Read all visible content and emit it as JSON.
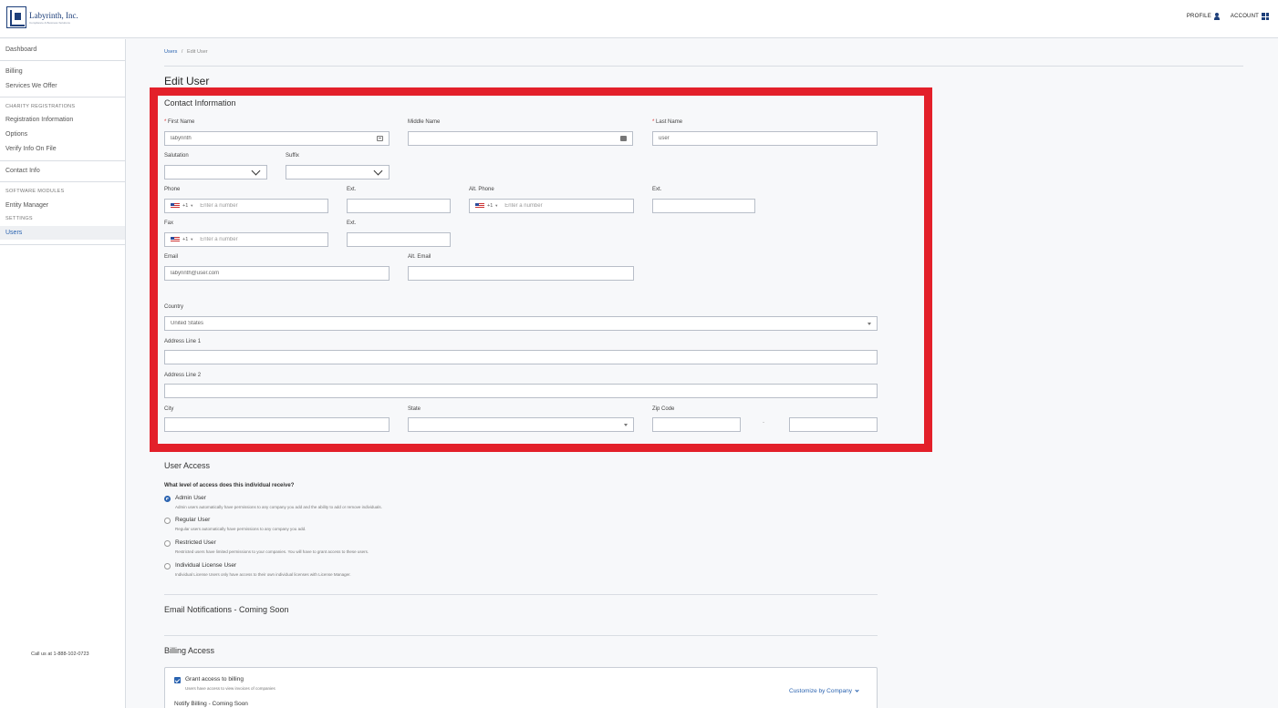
{
  "header": {
    "logo_text": "Labyrinth, Inc.",
    "logo_tagline": "Compliance & Business Solutions",
    "profile_label": "PROFILE",
    "account_label": "ACCOUNT"
  },
  "sidebar": {
    "items": {
      "dashboard": "Dashboard",
      "billing": "Billing",
      "services": "Services We Offer",
      "charity_heading": "CHARITY REGISTRATIONS",
      "registration_info": "Registration Information",
      "options": "Options",
      "verify_info": "Verify Info On File",
      "contact_info": "Contact Info",
      "software_heading": "SOFTWARE MODULES",
      "entity_manager": "Entity Manager",
      "settings_heading": "SETTINGS",
      "users": "Users"
    },
    "call_us": "Call us at 1-888-102-0723"
  },
  "breadcrumb": {
    "parent": "Users",
    "separator": "/",
    "current": "Edit User"
  },
  "page_title": "Edit User",
  "contact": {
    "title": "Contact Information",
    "first_name": {
      "label": "First Name",
      "required_mark": "*",
      "value": "labyrinth"
    },
    "middle_name": {
      "label": "Middle Name",
      "value": ""
    },
    "last_name": {
      "label": "Last Name",
      "required_mark": "*",
      "value": "user"
    },
    "salutation": {
      "label": "Salutation",
      "value": ""
    },
    "suffix": {
      "label": "Suffix",
      "value": ""
    },
    "phone": {
      "label": "Phone",
      "dial_code": "+1",
      "placeholder": "Enter a number"
    },
    "phone_ext": {
      "label": "Ext.",
      "value": ""
    },
    "alt_phone": {
      "label": "Alt. Phone",
      "dial_code": "+1",
      "placeholder": "Enter a number"
    },
    "alt_phone_ext": {
      "label": "Ext.",
      "value": ""
    },
    "fax": {
      "label": "Fax",
      "dial_code": "+1",
      "placeholder": "Enter a number"
    },
    "fax_ext": {
      "label": "Ext.",
      "value": ""
    },
    "email": {
      "label": "Email",
      "value": "labyrinth@user.com"
    },
    "alt_email": {
      "label": "Alt. Email",
      "value": ""
    },
    "country": {
      "label": "Country",
      "value": "United States"
    },
    "address1": {
      "label": "Address Line 1",
      "value": ""
    },
    "address2": {
      "label": "Address Line 2",
      "value": ""
    },
    "city": {
      "label": "City",
      "value": ""
    },
    "state": {
      "label": "State",
      "value": ""
    },
    "zip": {
      "label": "Zip Code",
      "value": "",
      "separator": "-",
      "ext_value": ""
    }
  },
  "user_access": {
    "title": "User Access",
    "question": "What level of access does this individual receive?",
    "options": [
      {
        "title": "Admin User",
        "desc": "Admin users automatically have permissions to any company you add and the ability to add or remove individuals.",
        "selected": true
      },
      {
        "title": "Regular User",
        "desc": "Regular users automatically have permissions to any company you add.",
        "selected": false
      },
      {
        "title": "Restricted User",
        "desc": "Restricted users have limited permissions to your companies. You will have to grant access to these users.",
        "selected": false
      },
      {
        "title": "Individual License User",
        "desc": "Individual License Users only have access to their own individual licenses with License Manager.",
        "selected": false
      }
    ]
  },
  "email_notifications": {
    "title": "Email Notifications - Coming Soon"
  },
  "billing_access": {
    "title": "Billing Access",
    "grant_label": "Grant access to billing",
    "grant_desc": "Users have access to view invoices of companies",
    "customize_label": "Customize by Company",
    "notify_label": "Notify Billing - Coming Soon"
  },
  "colors": {
    "accent": "#2a63b0",
    "highlight_border": "#e3202a"
  }
}
